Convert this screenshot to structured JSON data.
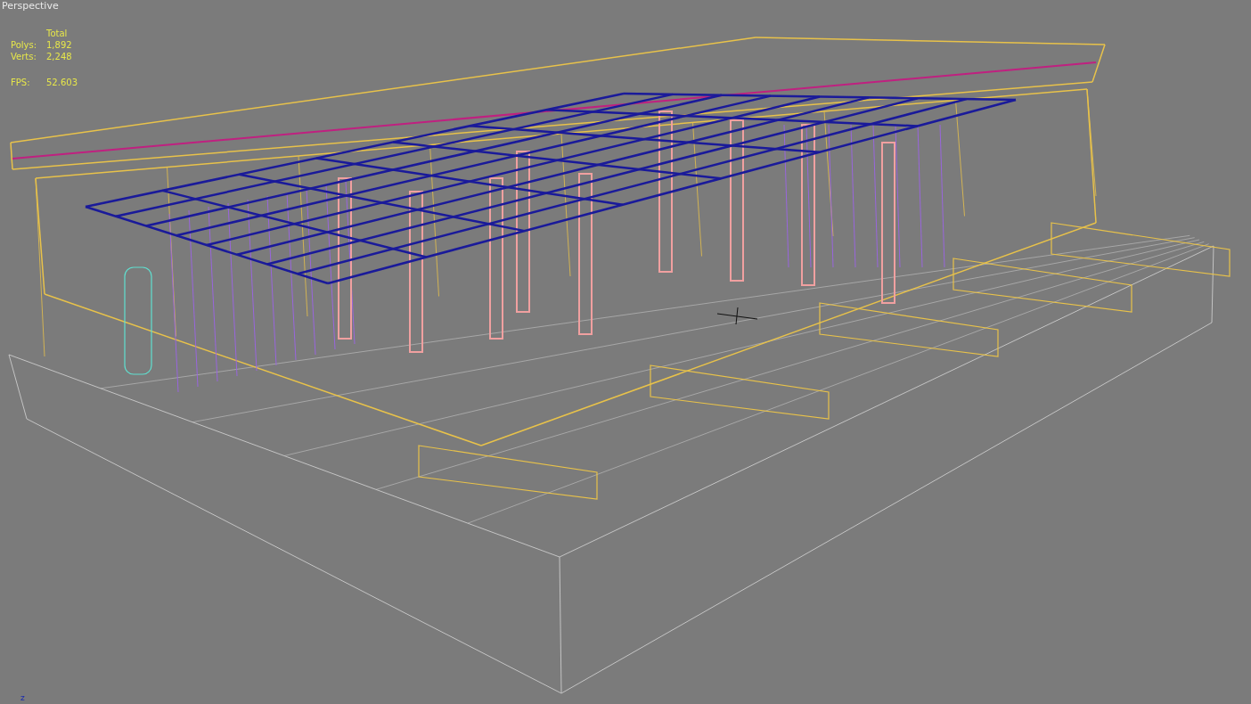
{
  "viewport": {
    "label": "Perspective",
    "stats": {
      "header": "Total",
      "rows": [
        {
          "label": "Polys:",
          "value": "1,892"
        },
        {
          "label": "Verts:",
          "value": "2,248"
        }
      ],
      "fps_label": "FPS:",
      "fps_value": "52.603"
    },
    "axis_label": "z"
  }
}
